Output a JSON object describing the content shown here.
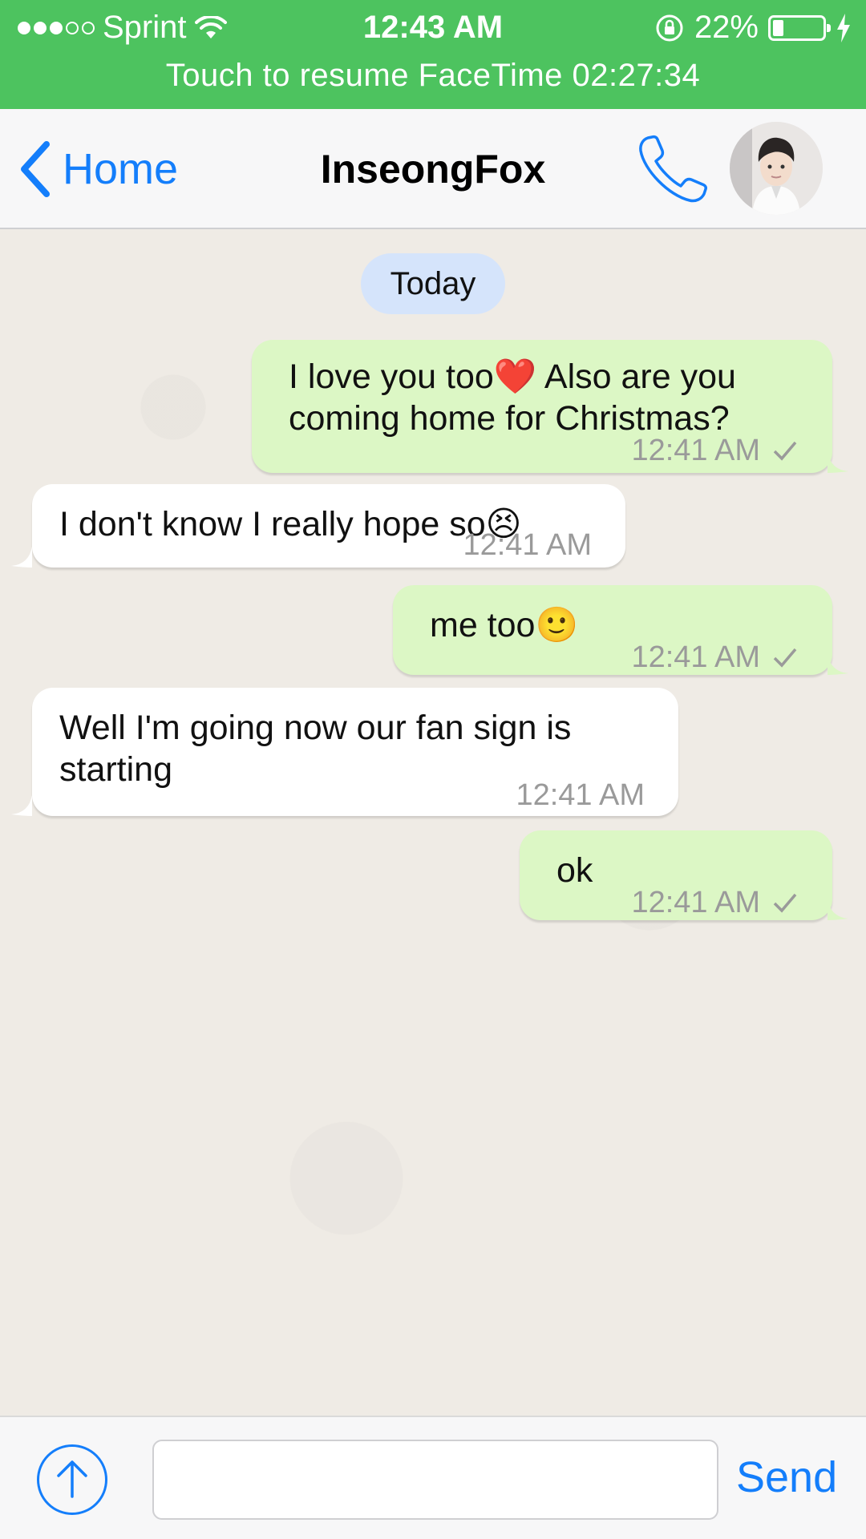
{
  "status_bar": {
    "carrier": "Sprint",
    "signal_bars_filled": 3,
    "signal_bars_total": 5,
    "time": "12:43 AM",
    "battery_percent": "22%",
    "battery_level": 0.22,
    "banner": "Touch to resume FaceTime 02:27:34",
    "color": "#4dc35f"
  },
  "nav": {
    "back_label": "Home",
    "title": "InseongFox",
    "accent": "#147efb"
  },
  "chat": {
    "date_label": "Today",
    "messages": [
      {
        "dir": "out",
        "text": "I love you too❤️ Also are you\ncoming home for Christmas?",
        "time": "12:41 AM",
        "read": true
      },
      {
        "dir": "in",
        "text": "I don't know I really hope so😣",
        "time": "12:41 AM"
      },
      {
        "dir": "out",
        "text": "me too🙂",
        "time": "12:41 AM",
        "read": true
      },
      {
        "dir": "in",
        "text": "Well I'm going now our fan sign is\nstarting",
        "time": "12:41 AM"
      },
      {
        "dir": "out",
        "text": "ok",
        "time": "12:41 AM",
        "read": true
      }
    ]
  },
  "input_bar": {
    "placeholder": "",
    "value": "",
    "send_label": "Send"
  }
}
